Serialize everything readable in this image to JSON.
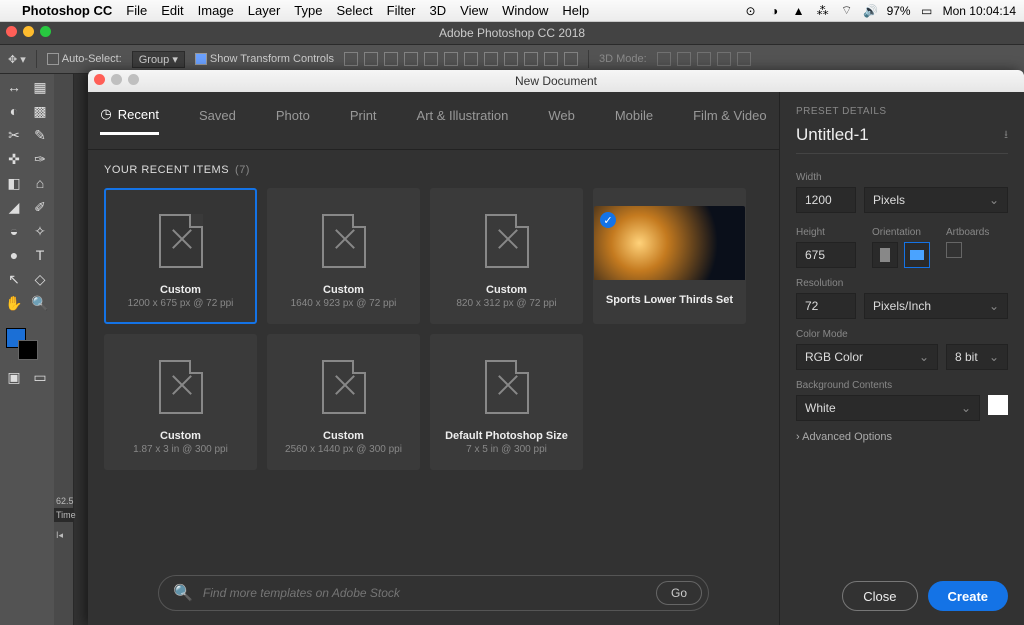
{
  "mac_menu": {
    "apple": "",
    "app": "Photoshop CC",
    "items": [
      "File",
      "Edit",
      "Image",
      "Layer",
      "Type",
      "Select",
      "Filter",
      "3D",
      "View",
      "Window",
      "Help"
    ],
    "battery": "97%",
    "clock": "Mon 10:04:14"
  },
  "app_title": "Adobe Photoshop CC 2018",
  "options": {
    "auto_select_label": "Auto-Select:",
    "auto_select_value": "Group",
    "show_transform_label": "Show Transform Controls",
    "mode3d_label": "3D Mode:"
  },
  "ruler": {
    "t1": "62.5",
    "t2": "Time"
  },
  "modal": {
    "title": "New Document",
    "tabs": [
      "Recent",
      "Saved",
      "Photo",
      "Print",
      "Art & Illustration",
      "Web",
      "Mobile",
      "Film & Video"
    ],
    "active_tab": 0,
    "section_label": "YOUR RECENT ITEMS",
    "section_count": "(7)",
    "items": [
      {
        "title": "Custom",
        "sub": "1200 x 675 px @ 72 ppi",
        "selected": true
      },
      {
        "title": "Custom",
        "sub": "1640 x 923 px @ 72 ppi"
      },
      {
        "title": "Custom",
        "sub": "820 x 312 px @ 72 ppi"
      },
      {
        "title": "Sports Lower Thirds Set",
        "sub": "",
        "image": true
      },
      {
        "title": "Custom",
        "sub": "1.87 x 3 in @ 300 ppi"
      },
      {
        "title": "Custom",
        "sub": "2560 x 1440 px @ 300 ppi"
      },
      {
        "title": "Default Photoshop Size",
        "sub": "7 x 5 in @ 300 ppi"
      }
    ],
    "search_placeholder": "Find more templates on Adobe Stock",
    "go_label": "Go"
  },
  "preset": {
    "heading": "PRESET DETAILS",
    "name": "Untitled-1",
    "width_label": "Width",
    "width_value": "1200",
    "width_unit": "Pixels",
    "height_label": "Height",
    "height_value": "675",
    "orientation_label": "Orientation",
    "artboards_label": "Artboards",
    "resolution_label": "Resolution",
    "resolution_value": "72",
    "resolution_unit": "Pixels/Inch",
    "colormode_label": "Color Mode",
    "colormode_value": "RGB Color",
    "colordepth_value": "8 bit",
    "bg_label": "Background Contents",
    "bg_value": "White",
    "advanced_label": "Advanced Options",
    "close_label": "Close",
    "create_label": "Create"
  },
  "tools": [
    "↔",
    "▦",
    "◐",
    "▩",
    "✂",
    "✎",
    "✜",
    "✑",
    "◧",
    "⌂",
    "◢",
    "✐",
    "◒",
    "✧",
    "●",
    "A",
    "⬚",
    "T",
    "↖",
    "◇",
    "✋",
    "🔍"
  ]
}
